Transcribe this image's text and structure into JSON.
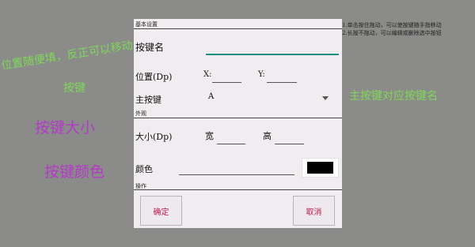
{
  "dialog": {
    "section_basic": "基本设置",
    "name_label": "按键名",
    "name_value": "",
    "position_label": "位置(Dp)",
    "x_label": "X:",
    "y_label": "Y:",
    "x_value": "",
    "y_value": "",
    "main_key_label": "主按键",
    "main_key_value": "A",
    "section_appearance": "外观",
    "size_label": "大小(Dp)",
    "width_label": "宽",
    "height_label": "高",
    "width_value": "",
    "height_value": "",
    "color_label": "颜色",
    "color_value": "",
    "swatch_color": "#000000",
    "section_actions": "操作",
    "confirm_label": "确定",
    "cancel_label": "取消"
  },
  "annotations": {
    "position_hint": "位置随便填，反正可以移动",
    "position_hint_2": "按键",
    "size_hint": "按键大小",
    "color_hint": "按键颜色",
    "main_key_hint": "主按键对应按键名"
  },
  "tips": [
    "1.单击按住拖动，可以使按键随手指移动",
    "2.长按不拖动，可以编辑或删除选中按钮"
  ]
}
